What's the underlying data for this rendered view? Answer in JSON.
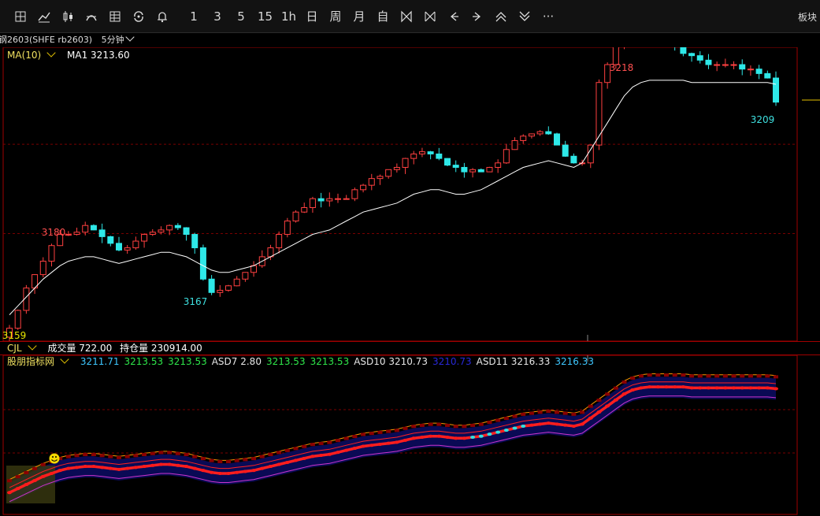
{
  "toolbar": {
    "buttons": [
      {
        "icon": "grid-icon",
        "label": ""
      },
      {
        "icon": "line-chart-icon",
        "label": ""
      },
      {
        "icon": "candle-icon",
        "label": ""
      },
      {
        "icon": "indicator-icon",
        "label": ""
      },
      {
        "icon": "table-icon",
        "label": ""
      },
      {
        "icon": "sync-icon",
        "label": ""
      },
      {
        "icon": "alarm-bell-icon",
        "label": ""
      },
      {
        "icon": "",
        "label": "1"
      },
      {
        "icon": "",
        "label": "3"
      },
      {
        "icon": "",
        "label": "5"
      },
      {
        "icon": "",
        "label": "15"
      },
      {
        "icon": "",
        "label": "1h"
      },
      {
        "icon": "",
        "label": "日"
      },
      {
        "icon": "",
        "label": "周"
      },
      {
        "icon": "",
        "label": "月"
      },
      {
        "icon": "",
        "label": "自"
      },
      {
        "icon": "zoom-in-icon",
        "label": ""
      },
      {
        "icon": "zoom-out-icon",
        "label": ""
      },
      {
        "icon": "arrow-left-icon",
        "label": ""
      },
      {
        "icon": "arrow-right-icon",
        "label": ""
      },
      {
        "icon": "arrow-up-icon",
        "label": ""
      },
      {
        "icon": "arrow-down-icon",
        "label": ""
      },
      {
        "icon": "",
        "label": "···"
      }
    ],
    "right_label": "板块"
  },
  "header": {
    "contract": "钢2603(SHFE rb2603)",
    "period": "5分钟"
  },
  "main_legend": {
    "indicator": "MA(10)",
    "ma1": "MA1 3213.60"
  },
  "volume_legend": {
    "indicator": "CJL",
    "volume": "成交量 722.00",
    "open_interest": "持仓量 230914.00"
  },
  "asd_legend": {
    "indicator": "股朋指标网",
    "values": [
      {
        "text": "3211.71",
        "color": "#3ec7ff"
      },
      {
        "text": "3213.53",
        "color": "#2ee64a"
      },
      {
        "text": "3213.53",
        "color": "#2ee64a"
      },
      {
        "text": "ASD7 2.80",
        "color": "#e6e6e6"
      },
      {
        "text": "3213.53",
        "color": "#2ee64a"
      },
      {
        "text": "3213.53",
        "color": "#2ee64a"
      },
      {
        "text": "ASD10 3210.73",
        "color": "#e6e6e6"
      },
      {
        "text": "3210.73",
        "color": "#2828d8"
      },
      {
        "text": "ASD11 3216.33",
        "color": "#e6e6e6"
      },
      {
        "text": "3216.33",
        "color": "#3ec7ff"
      }
    ]
  },
  "colors": {
    "up": "#ff4040",
    "down": "#2ee8e8",
    "ma": "#ffffff",
    "grid": "#7a0000",
    "border": "#a00000",
    "label_yellow": "#f0e060"
  },
  "chart_data": {
    "type": "candlestick",
    "annotations": [
      {
        "text": "3218",
        "value": 3218,
        "color": "#ff5050"
      },
      {
        "text": "3209",
        "value": 3209,
        "color": "#3ee0e0"
      },
      {
        "text": "3180",
        "value": 3180,
        "color": "#ff5050"
      },
      {
        "text": "3167",
        "value": 3167,
        "color": "#3ee0e0"
      },
      {
        "text": "3159",
        "value": 3159,
        "color": "#e6e600"
      }
    ],
    "y_range": [
      3157,
      3221
    ],
    "series": [
      {
        "name": "MA1",
        "values": [
          3162,
          3164,
          3166,
          3168,
          3170,
          3171.5,
          3173,
          3174,
          3174.5,
          3175,
          3175,
          3174.5,
          3174,
          3173.5,
          3174,
          3174.5,
          3175,
          3175.5,
          3176,
          3176,
          3175.5,
          3175,
          3174,
          3173,
          3172,
          3171.5,
          3171.5,
          3172,
          3172.5,
          3173,
          3174,
          3175,
          3176,
          3177,
          3178,
          3179,
          3180,
          3180.5,
          3181,
          3182,
          3183,
          3184,
          3185,
          3185.5,
          3186,
          3186.5,
          3187,
          3188,
          3189,
          3189.5,
          3190,
          3190,
          3189.5,
          3189,
          3189,
          3189.5,
          3190,
          3191,
          3192,
          3193,
          3194,
          3195,
          3195.5,
          3196,
          3196.5,
          3196,
          3195.5,
          3195,
          3196,
          3199,
          3202,
          3205,
          3208,
          3211,
          3213,
          3214,
          3214.5,
          3214.5,
          3214.5,
          3214.5,
          3214.5,
          3214,
          3214,
          3214,
          3214,
          3214,
          3214,
          3214,
          3214,
          3214,
          3214,
          3213.6
        ]
      }
    ]
  }
}
